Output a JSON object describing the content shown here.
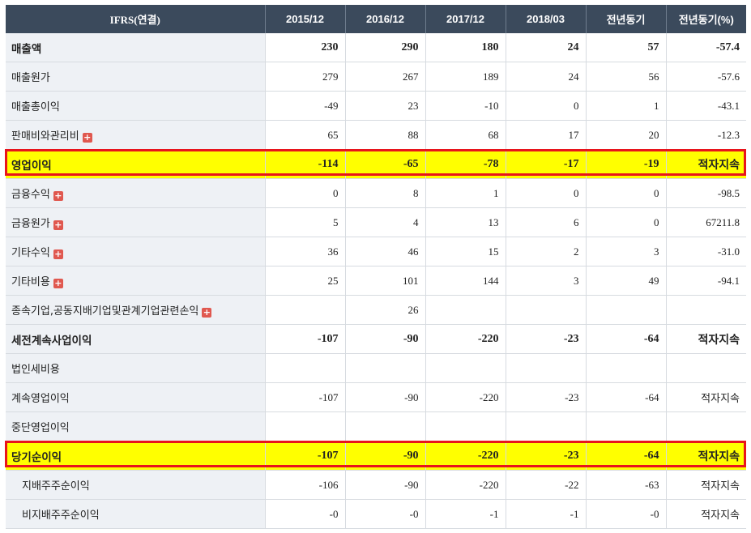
{
  "header": {
    "label": "IFRS(연결)",
    "columns": [
      "2015/12",
      "2016/12",
      "2017/12",
      "2018/03",
      "전년동기",
      "전년동기(%)"
    ]
  },
  "rows": [
    {
      "label": "매출액",
      "values": [
        "230",
        "290",
        "180",
        "24",
        "57",
        "-57.4"
      ],
      "bold": true
    },
    {
      "label": "매출원가",
      "values": [
        "279",
        "267",
        "189",
        "24",
        "56",
        "-57.6"
      ]
    },
    {
      "label": "매출총이익",
      "values": [
        "-49",
        "23",
        "-10",
        "0",
        "1",
        "-43.1"
      ]
    },
    {
      "label": "판매비와관리비",
      "values": [
        "65",
        "88",
        "68",
        "17",
        "20",
        "-12.3"
      ],
      "expand": true
    },
    {
      "label": "영업이익",
      "values": [
        "-114",
        "-65",
        "-78",
        "-17",
        "-19",
        "적자지속"
      ],
      "bold": true,
      "highlight": true
    },
    {
      "label": "금융수익",
      "values": [
        "0",
        "8",
        "1",
        "0",
        "0",
        "-98.5"
      ],
      "expand": true
    },
    {
      "label": "금융원가",
      "values": [
        "5",
        "4",
        "13",
        "6",
        "0",
        "67211.8"
      ],
      "expand": true
    },
    {
      "label": "기타수익",
      "values": [
        "36",
        "46",
        "15",
        "2",
        "3",
        "-31.0"
      ],
      "expand": true
    },
    {
      "label": "기타비용",
      "values": [
        "25",
        "101",
        "144",
        "3",
        "49",
        "-94.1"
      ],
      "expand": true
    },
    {
      "label": "종속기업,공동지배기업및관계기업관련손익",
      "values": [
        "",
        "26",
        "",
        "",
        "",
        ""
      ],
      "expand": true
    },
    {
      "label": "세전계속사업이익",
      "values": [
        "-107",
        "-90",
        "-220",
        "-23",
        "-64",
        "적자지속"
      ],
      "bold": true
    },
    {
      "label": "법인세비용",
      "values": [
        "",
        "",
        "",
        "",
        "",
        ""
      ]
    },
    {
      "label": "계속영업이익",
      "values": [
        "-107",
        "-90",
        "-220",
        "-23",
        "-64",
        "적자지속"
      ]
    },
    {
      "label": "중단영업이익",
      "values": [
        "",
        "",
        "",
        "",
        "",
        ""
      ]
    },
    {
      "label": "당기순이익",
      "values": [
        "-107",
        "-90",
        "-220",
        "-23",
        "-64",
        "적자지속"
      ],
      "bold": true,
      "highlight": true
    },
    {
      "label": "지배주주순이익",
      "values": [
        "-106",
        "-90",
        "-220",
        "-22",
        "-63",
        "적자지속"
      ],
      "indent": true
    },
    {
      "label": "비지배주주순이익",
      "values": [
        "-0",
        "-0",
        "-1",
        "-1",
        "-0",
        "적자지속"
      ],
      "indent": true
    }
  ],
  "colors": {
    "header_bg": "#3b4a5c",
    "label_bg": "#eef1f5",
    "negative": "#e0000b",
    "highlight": "#ffff00",
    "highlight_border": "#e8141c"
  },
  "icons": {
    "expand": "plus-icon"
  }
}
